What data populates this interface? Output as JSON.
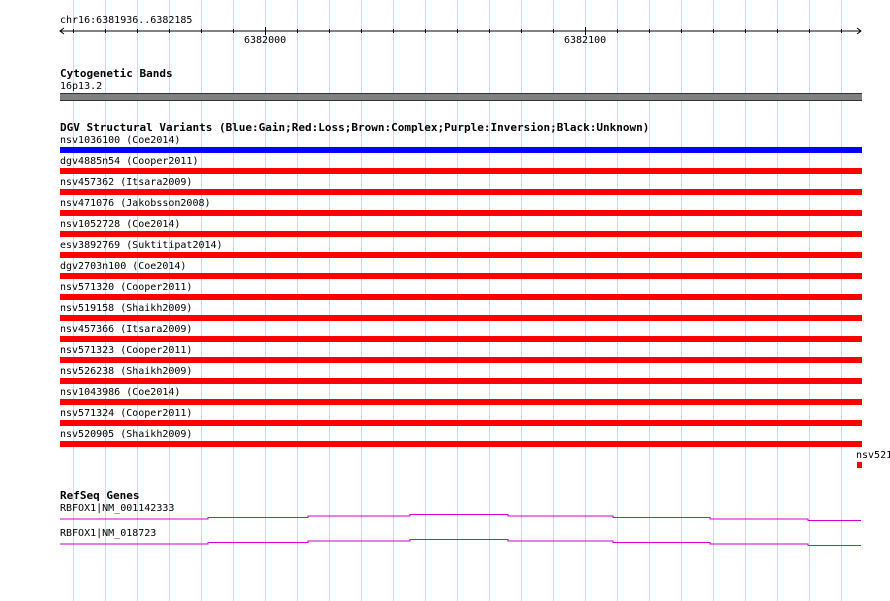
{
  "ruler": {
    "region": "chr16:6381936..6382185",
    "tick_labels": [
      "6382000",
      "6382100"
    ]
  },
  "cytoband_track": {
    "title": "Cytogenetic Bands",
    "band": "16p13.2",
    "band_color": "#808080"
  },
  "dgv_track": {
    "title": "DGV Structural Variants (Blue:Gain;Red:Loss;Brown:Complex;Purple:Inversion;Black:Unknown)",
    "colors": {
      "gain": "#0000ff",
      "loss": "#ff0000"
    },
    "variants": [
      {
        "label": "nsv1036100 (Coe2014)",
        "type": "gain"
      },
      {
        "label": "dgv4885n54 (Cooper2011)",
        "type": "loss"
      },
      {
        "label": "nsv457362 (Itsara2009)",
        "type": "loss"
      },
      {
        "label": "nsv471076 (Jakobsson2008)",
        "type": "loss"
      },
      {
        "label": "nsv1052728 (Coe2014)",
        "type": "loss"
      },
      {
        "label": "esv3892769 (Suktitipat2014)",
        "type": "loss"
      },
      {
        "label": "dgv2703n100 (Coe2014)",
        "type": "loss"
      },
      {
        "label": "nsv571320 (Cooper2011)",
        "type": "loss"
      },
      {
        "label": "nsv519158 (Shaikh2009)",
        "type": "loss"
      },
      {
        "label": "nsv457366 (Itsara2009)",
        "type": "loss"
      },
      {
        "label": "nsv571323 (Cooper2011)",
        "type": "loss"
      },
      {
        "label": "nsv526238 (Shaikh2009)",
        "type": "loss"
      },
      {
        "label": "nsv1043986 (Coe2014)",
        "type": "loss"
      },
      {
        "label": "nsv571324 (Cooper2011)",
        "type": "loss"
      },
      {
        "label": "nsv520905 (Shaikh2009)",
        "type": "loss"
      }
    ],
    "overflow_label": "nsv521"
  },
  "refseq_track": {
    "title": "RefSeq Genes",
    "intron_color": "#cc00cc",
    "genes": [
      {
        "label": "RBFOX1|NM_001142333"
      },
      {
        "label": "RBFOX1|NM_018723"
      }
    ]
  }
}
